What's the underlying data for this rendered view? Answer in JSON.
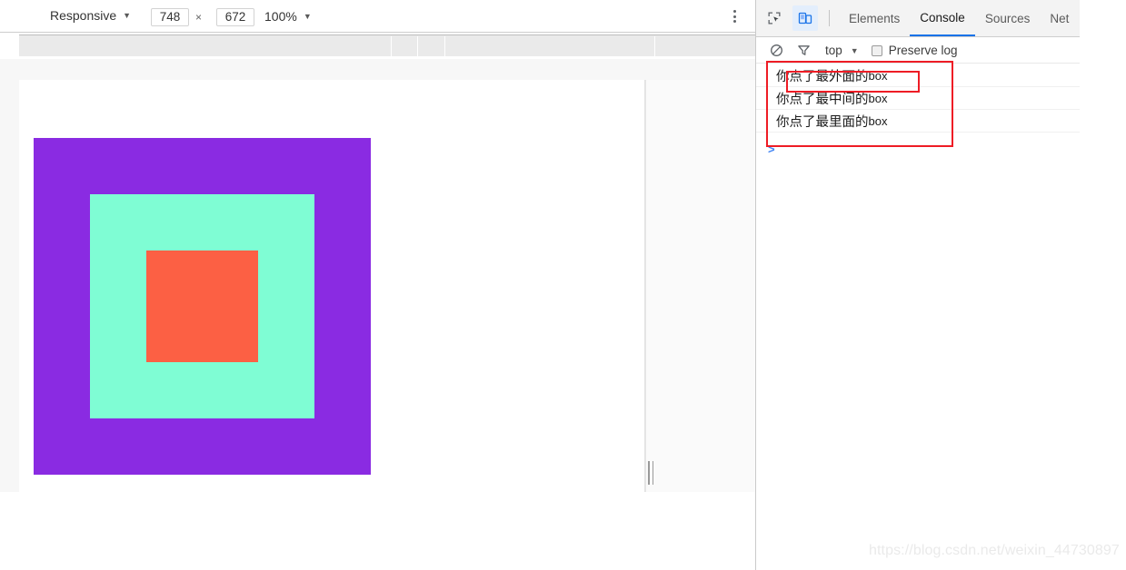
{
  "device_toolbar": {
    "device_preset": "Responsive",
    "width": "748",
    "times": "×",
    "height": "672",
    "zoom": "100%",
    "caret": "▼",
    "more_options_icon": "kebab-menu-icon"
  },
  "page": {
    "boxes": [
      {
        "name": "outer",
        "color": "#8a2be2"
      },
      {
        "name": "middle",
        "color": "#7ffdd4"
      },
      {
        "name": "inner",
        "color": "#fc6044"
      }
    ]
  },
  "devtools": {
    "icons": {
      "inspect": "inspect-element-icon",
      "device_toolbar": "toggle-device-toolbar-icon",
      "clear_console": "clear-console-icon",
      "filter": "filter-icon"
    },
    "tabs": [
      {
        "label": "Elements",
        "selected": false
      },
      {
        "label": "Console",
        "selected": true
      },
      {
        "label": "Sources",
        "selected": false
      },
      {
        "label": "Net",
        "selected": false
      }
    ],
    "console_bar": {
      "context": "top",
      "caret": "▼",
      "preserve_log": "Preserve log",
      "preserve_log_checked": false
    },
    "console_messages": [
      {
        "cn": "你点了最外面的",
        "latin": "box",
        "annotated": true
      },
      {
        "cn": "你点了最中间的",
        "latin": "box",
        "annotated": false
      },
      {
        "cn": "你点了最里面的",
        "latin": "box",
        "annotated": false
      }
    ],
    "prompt": ">",
    "annotation_color": "#ee1c25"
  },
  "watermark": "https://blog.csdn.net/weixin_44730897"
}
